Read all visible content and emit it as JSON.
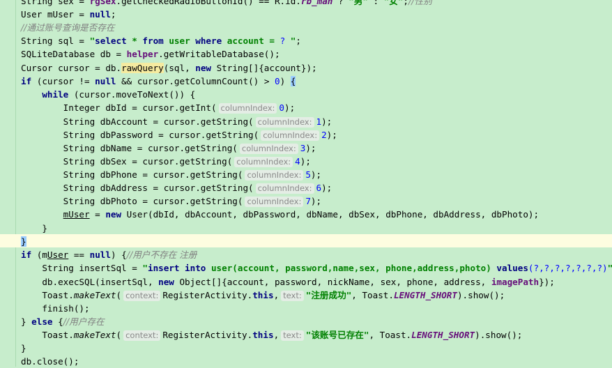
{
  "l0": {
    "a": "String sex = ",
    "b": "rgSex",
    "c": ".getCheckedRadioButtonId() == R.id.",
    "d": "rb_man",
    "e": " ? ",
    "f": "\"男\"",
    "g": " : ",
    "h": "\"女\"",
    "i": ";",
    "j": "//性别"
  },
  "l1": {
    "a": "User mUser = ",
    "b": "null",
    "c": ";"
  },
  "l2": {
    "a": "//通过账号查询是否存在"
  },
  "l3": {
    "a": "String sql = ",
    "b": "\"",
    "c": "select",
    "d": " * ",
    "e": "from",
    "f": " user ",
    "g": "where",
    "h": " account = ",
    "i": "?",
    "j": " \"",
    "k": ";"
  },
  "l4": {
    "a": "SQLiteDatabase db = ",
    "b": "helper",
    "c": ".getWritableDatabase();"
  },
  "l5": {
    "a": "Cursor cursor = db.",
    "b": "rawQuery",
    "c": "(sql, ",
    "d": "new",
    "e": " String[]{account});"
  },
  "l6": {
    "a": "if",
    "b": " (cursor != ",
    "c": "null",
    "d": " && cursor.getColumnCount() > ",
    "e": "0",
    "f": ") ",
    "g": "{"
  },
  "l7": {
    "a": "    ",
    "b": "while",
    "c": " (cursor.moveToNext()) {"
  },
  "l8": {
    "a": "        Integer dbId = cursor.getInt(",
    "h": "columnIndex:",
    "n": "0",
    "z": ");"
  },
  "l9": {
    "a": "        String dbAccount = cursor.getString(",
    "h": "columnIndex:",
    "n": "1",
    "z": ");"
  },
  "l10": {
    "a": "        String dbPassword = cursor.getString(",
    "h": "columnIndex:",
    "n": "2",
    "z": ");"
  },
  "l11": {
    "a": "        String dbName = cursor.getString(",
    "h": "columnIndex:",
    "n": "3",
    "z": ");"
  },
  "l12": {
    "a": "        String dbSex = cursor.getString(",
    "h": "columnIndex:",
    "n": "4",
    "z": ");"
  },
  "l13": {
    "a": "        String dbPhone = cursor.getString(",
    "h": "columnIndex:",
    "n": "5",
    "z": ");"
  },
  "l14": {
    "a": "        String dbAddress = cursor.getString(",
    "h": "columnIndex:",
    "n": "6",
    "z": ");"
  },
  "l15": {
    "a": "        String dbPhoto = cursor.getString(",
    "h": "columnIndex:",
    "n": "7",
    "z": ");"
  },
  "l16": {
    "a": "        ",
    "b": "mUser",
    "c": " = ",
    "d": "new",
    "e": " User(dbId, dbAccount, dbPassword, dbName, dbSex, dbPhone, dbAddress, dbPhoto);"
  },
  "l17": {
    "a": "    }"
  },
  "l18": {
    "a": "}"
  },
  "l19": {
    "a": "if",
    "b": " (m",
    "c": "User",
    "d": " == ",
    "e": "null",
    "f": ") {",
    "g": "//用户不存在 注册"
  },
  "l20": {
    "a": "    String insertSql = ",
    "b": "\"",
    "c": "insert into",
    "d": " user(account, password,name,sex, phone,address,photo) ",
    "e": "values",
    "f": "(?,?,?,?,?,?,?)",
    "g": "\"",
    "h": ";"
  },
  "l21": {
    "a": "    db.execSQL(insertSql, ",
    "b": "new",
    "c": " Object[]{account, password, nickName, sex, phone, address, ",
    "d": "imagePath",
    "e": "});"
  },
  "l22": {
    "a": "    Toast.",
    "b": "makeText",
    "c": "(",
    "h": "context:",
    "d": "RegisterActivity.",
    "e": "this",
    "f": ",",
    "h2": "text:",
    "g": "\"注册成功\"",
    "i": ", Toast.",
    "j": "LENGTH_SHORT",
    "k": ").show();"
  },
  "l23": {
    "a": "    finish();"
  },
  "l24": {
    "a": "} ",
    "b": "else",
    "c": " {",
    "d": "//用户存在"
  },
  "l25": {
    "a": "    Toast.",
    "b": "makeText",
    "c": "(",
    "h": "context:",
    "d": "RegisterActivity.",
    "e": "this",
    "f": ",",
    "h2": "text:",
    "g": "\"该账号已存在\"",
    "i": ", Toast.",
    "j": "LENGTH_SHORT",
    "k": ").show();"
  },
  "l26": {
    "a": "}"
  },
  "l27": {
    "a": "db.close();"
  }
}
